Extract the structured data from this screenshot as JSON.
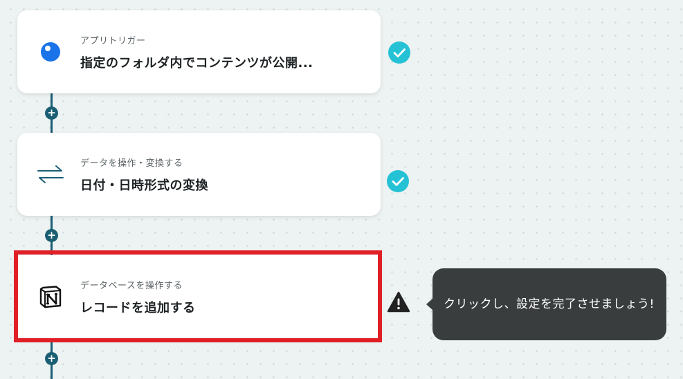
{
  "flow": {
    "steps": [
      {
        "subtitle": "アプリトリガー",
        "title": "指定のフォルダ内でコンテンツが公開...",
        "icon": "app-trigger-dot-icon",
        "status": "complete"
      },
      {
        "subtitle": "データを操作・変換する",
        "title": "日付・日時形式の変換",
        "icon": "convert-arrows-icon",
        "status": "complete"
      },
      {
        "subtitle": "データベースを操作する",
        "title": "レコードを追加する",
        "icon": "notion-icon",
        "status": "warning"
      }
    ],
    "add_button_label": "+"
  },
  "tooltip": {
    "text": "クリックし、設定を完了させましょう!"
  },
  "colors": {
    "connector": "#1a5e73",
    "check": "#25c2d6",
    "highlight": "#e01f26",
    "tooltip_bg": "#3a3d3d",
    "trigger_dot": "#1a73e8"
  }
}
